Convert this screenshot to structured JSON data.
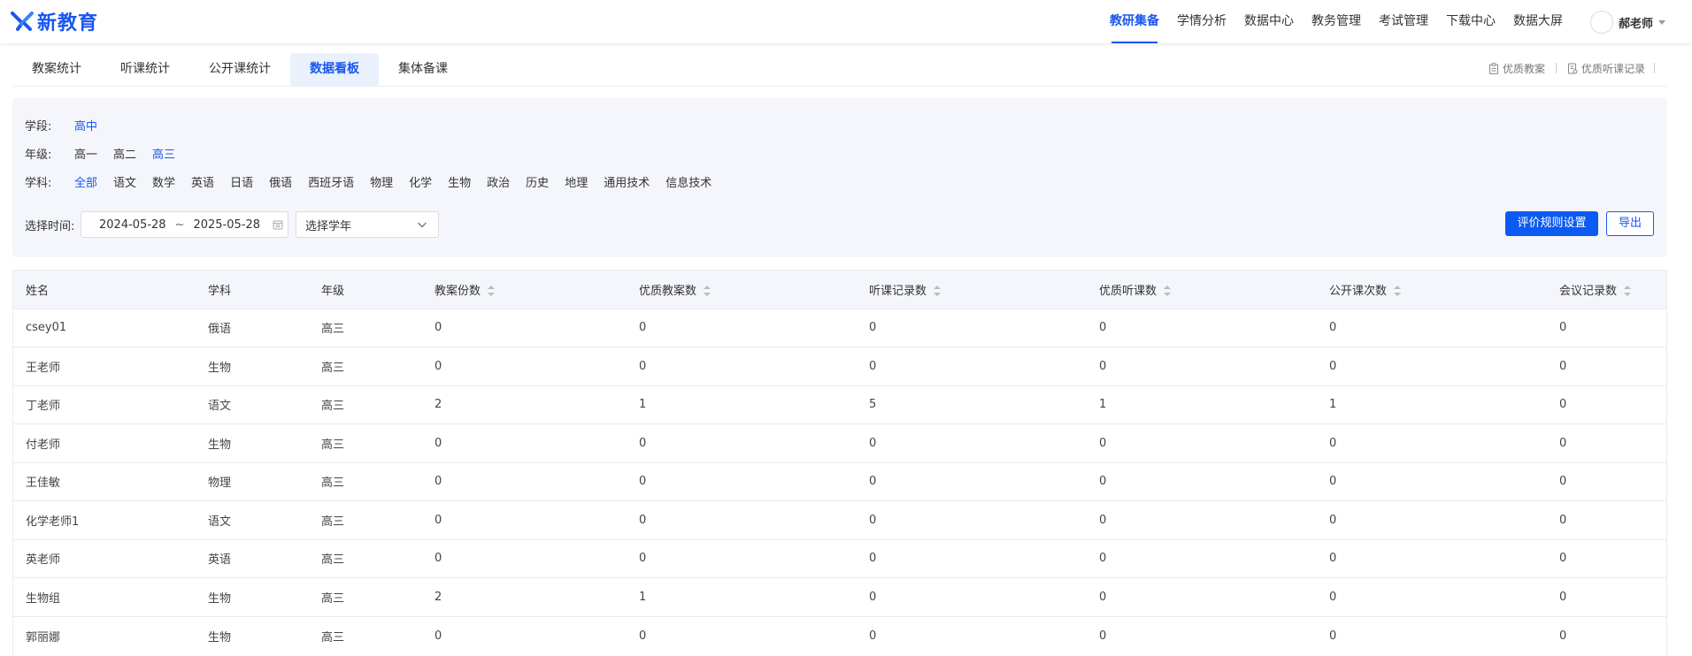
{
  "header": {
    "logo_text": "新教育",
    "nav": [
      "教研集备",
      "学情分析",
      "数据中心",
      "教务管理",
      "考试管理",
      "下载中心",
      "数据大屏"
    ],
    "active_nav": 0,
    "user_name": "郝老师",
    "icons": {
      "logo": "x-mark-logo-icon",
      "avatar": "avatar-icon",
      "user_menu": "caret-down-icon"
    }
  },
  "subtabs": {
    "items": [
      "教案统计",
      "听课统计",
      "公开课统计",
      "数据看板",
      "集体备课"
    ],
    "active": 3
  },
  "quicklinks": [
    {
      "label": "优质教案",
      "icon": "clipboard-icon"
    },
    {
      "label": "优质听课记录",
      "icon": "document-icon"
    }
  ],
  "filters": {
    "stage_label": "学段:",
    "stage_options": [
      "高中"
    ],
    "stage_active": 0,
    "grade_label": "年级:",
    "grade_options": [
      "高一",
      "高二",
      "高三"
    ],
    "grade_active": 2,
    "subject_label": "学科:",
    "subject_options": [
      "全部",
      "语文",
      "数学",
      "英语",
      "日语",
      "俄语",
      "西班牙语",
      "物理",
      "化学",
      "生物",
      "政治",
      "历史",
      "地理",
      "通用技术",
      "信息技术"
    ],
    "subject_active": 0,
    "time_label": "选择时间:",
    "date_start": "2024-05-28",
    "date_sep": "~",
    "date_end": "2025-05-28",
    "year_placeholder": "选择学年",
    "btn_rules": "评价规则设置",
    "btn_export": "导出",
    "colors": {
      "accent": "#1a56f0",
      "primary_button": "#0b5af2",
      "panel_bg": "#f4f6fb"
    }
  },
  "table": {
    "columns": [
      {
        "label": "姓名",
        "sortable": false
      },
      {
        "label": "学科",
        "sortable": false
      },
      {
        "label": "年级",
        "sortable": false
      },
      {
        "label": "教案份数",
        "sortable": true
      },
      {
        "label": "优质教案数",
        "sortable": true
      },
      {
        "label": "听课记录数",
        "sortable": true
      },
      {
        "label": "优质听课数",
        "sortable": true
      },
      {
        "label": "公开课次数",
        "sortable": true
      },
      {
        "label": "会议记录数",
        "sortable": true
      }
    ],
    "rows": [
      [
        "csey01",
        "俄语",
        "高三",
        "0",
        "0",
        "0",
        "0",
        "0",
        "0"
      ],
      [
        "王老师",
        "生物",
        "高三",
        "0",
        "0",
        "0",
        "0",
        "0",
        "0"
      ],
      [
        "丁老师",
        "语文",
        "高三",
        "2",
        "1",
        "5",
        "1",
        "1",
        "0"
      ],
      [
        "付老师",
        "生物",
        "高三",
        "0",
        "0",
        "0",
        "0",
        "0",
        "0"
      ],
      [
        "王佳敏",
        "物理",
        "高三",
        "0",
        "0",
        "0",
        "0",
        "0",
        "0"
      ],
      [
        "化学老师1",
        "语文",
        "高三",
        "0",
        "0",
        "0",
        "0",
        "0",
        "0"
      ],
      [
        "英老师",
        "英语",
        "高三",
        "0",
        "0",
        "0",
        "0",
        "0",
        "0"
      ],
      [
        "生物组",
        "生物",
        "高三",
        "2",
        "1",
        "0",
        "0",
        "0",
        "0"
      ],
      [
        "郭丽娜",
        "生物",
        "高三",
        "0",
        "0",
        "0",
        "0",
        "0",
        "0"
      ]
    ]
  }
}
